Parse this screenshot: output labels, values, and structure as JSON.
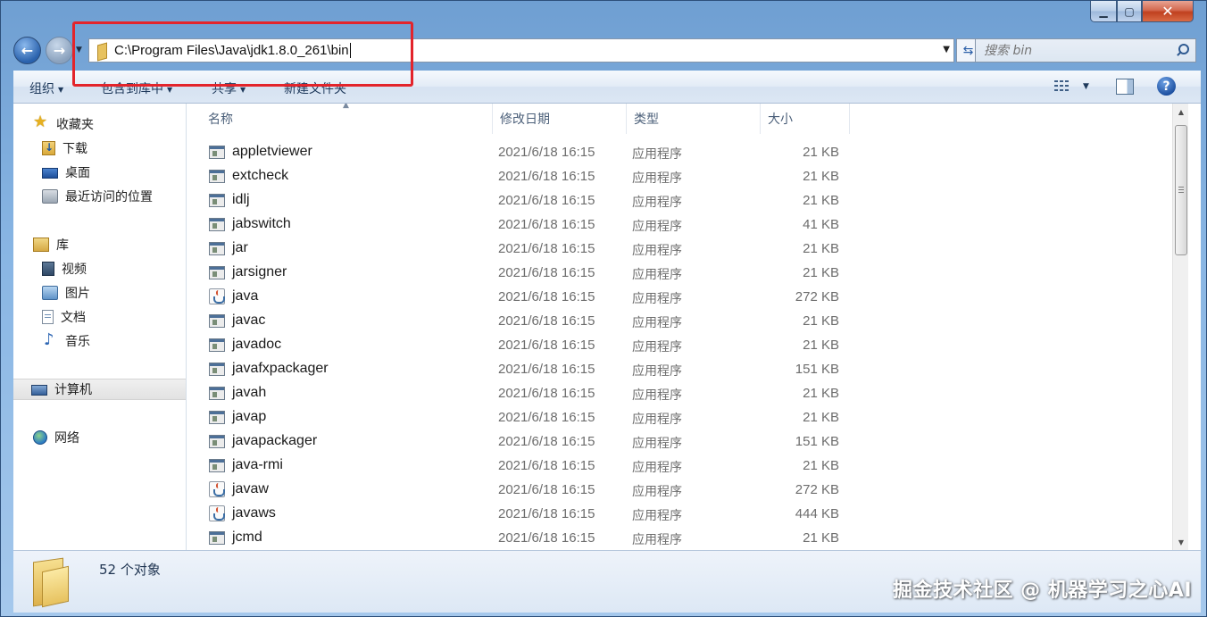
{
  "address": {
    "path": "C:\\Program Files\\Java\\jdk1.8.0_261\\bin"
  },
  "search": {
    "placeholder": "搜索 bin"
  },
  "toolbar": {
    "organize": "组织",
    "include_in_library": "包含到库中",
    "share": "共享",
    "new_folder": "新建文件夹"
  },
  "sidebar": {
    "favorites": "收藏夹",
    "downloads": "下载",
    "desktop": "桌面",
    "recent_places": "最近访问的位置",
    "libraries": "库",
    "videos": "视频",
    "pictures": "图片",
    "documents": "文档",
    "music": "音乐",
    "computer": "计算机",
    "network": "网络"
  },
  "columns": {
    "name": "名称",
    "date": "修改日期",
    "type": "类型",
    "size": "大小"
  },
  "files": [
    {
      "name": "appletviewer",
      "date": "2021/6/18 16:15",
      "type": "应用程序",
      "size": "21 KB",
      "icon": "exe"
    },
    {
      "name": "extcheck",
      "date": "2021/6/18 16:15",
      "type": "应用程序",
      "size": "21 KB",
      "icon": "exe"
    },
    {
      "name": "idlj",
      "date": "2021/6/18 16:15",
      "type": "应用程序",
      "size": "21 KB",
      "icon": "exe"
    },
    {
      "name": "jabswitch",
      "date": "2021/6/18 16:15",
      "type": "应用程序",
      "size": "41 KB",
      "icon": "exe"
    },
    {
      "name": "jar",
      "date": "2021/6/18 16:15",
      "type": "应用程序",
      "size": "21 KB",
      "icon": "exe"
    },
    {
      "name": "jarsigner",
      "date": "2021/6/18 16:15",
      "type": "应用程序",
      "size": "21 KB",
      "icon": "exe"
    },
    {
      "name": "java",
      "date": "2021/6/18 16:15",
      "type": "应用程序",
      "size": "272 KB",
      "icon": "java"
    },
    {
      "name": "javac",
      "date": "2021/6/18 16:15",
      "type": "应用程序",
      "size": "21 KB",
      "icon": "exe"
    },
    {
      "name": "javadoc",
      "date": "2021/6/18 16:15",
      "type": "应用程序",
      "size": "21 KB",
      "icon": "exe"
    },
    {
      "name": "javafxpackager",
      "date": "2021/6/18 16:15",
      "type": "应用程序",
      "size": "151 KB",
      "icon": "exe"
    },
    {
      "name": "javah",
      "date": "2021/6/18 16:15",
      "type": "应用程序",
      "size": "21 KB",
      "icon": "exe"
    },
    {
      "name": "javap",
      "date": "2021/6/18 16:15",
      "type": "应用程序",
      "size": "21 KB",
      "icon": "exe"
    },
    {
      "name": "javapackager",
      "date": "2021/6/18 16:15",
      "type": "应用程序",
      "size": "151 KB",
      "icon": "exe"
    },
    {
      "name": "java-rmi",
      "date": "2021/6/18 16:15",
      "type": "应用程序",
      "size": "21 KB",
      "icon": "exe"
    },
    {
      "name": "javaw",
      "date": "2021/6/18 16:15",
      "type": "应用程序",
      "size": "272 KB",
      "icon": "java"
    },
    {
      "name": "javaws",
      "date": "2021/6/18 16:15",
      "type": "应用程序",
      "size": "444 KB",
      "icon": "java"
    },
    {
      "name": "jcmd",
      "date": "2021/6/18 16:15",
      "type": "应用程序",
      "size": "21 KB",
      "icon": "exe"
    }
  ],
  "status": {
    "count": "52 个对象"
  },
  "watermark": "掘金技术社区 @ 机器学习之心AI"
}
